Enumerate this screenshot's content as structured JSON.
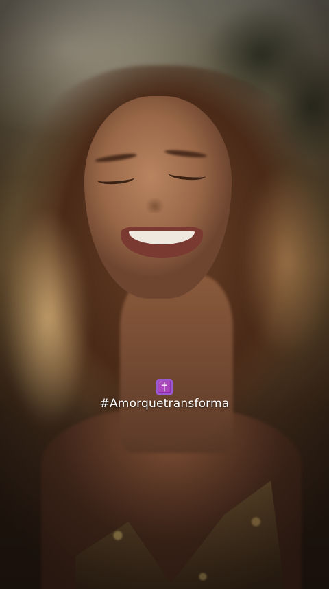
{
  "overlay": {
    "emoji": "✝️",
    "emoji_icon": "latin-cross-icon",
    "emoji_color": "#9b59d0",
    "hashtag": "#Amorquetransforma"
  }
}
